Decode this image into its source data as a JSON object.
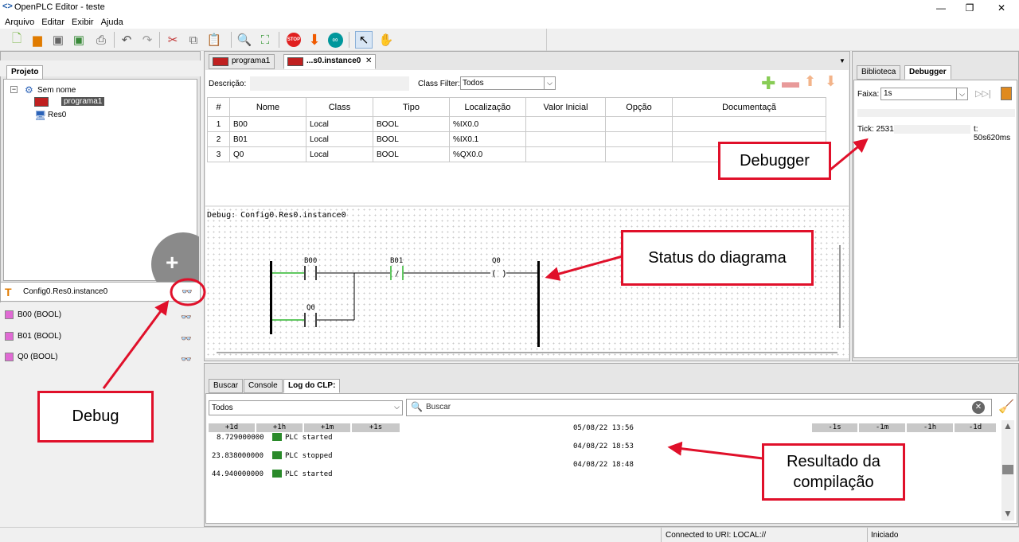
{
  "window": {
    "title": "OpenPLC Editor - teste",
    "logo": "<>"
  },
  "menu": [
    "Arquivo",
    "Editar",
    "Exibir",
    "Ajuda"
  ],
  "left_panel": {
    "tab": "Projeto",
    "tree": {
      "root": "Sem nome",
      "program": "programa1",
      "resource": "Res0"
    },
    "instance_label": "Config0.Res0.instance0",
    "variables": [
      "B00 (BOOL)",
      "B01 (BOOL)",
      "Q0 (BOOL)"
    ]
  },
  "editor": {
    "tabs": [
      "programa1",
      "...s0.instance0"
    ],
    "description_label": "Descrição:",
    "class_filter_label": "Class Filter:",
    "class_filter_value": "Todos",
    "columns": [
      "#",
      "Nome",
      "Class",
      "Tipo",
      "Localização",
      "Valor Inicial",
      "Opção",
      "Documentaçã"
    ],
    "rows": [
      [
        "1",
        "B00",
        "Local",
        "BOOL",
        "%IX0.0",
        "",
        "",
        ""
      ],
      [
        "2",
        "B01",
        "Local",
        "BOOL",
        "%IX0.1",
        "",
        "",
        ""
      ],
      [
        "3",
        "Q0",
        "Local",
        "BOOL",
        "%QX0.0",
        "",
        "",
        ""
      ]
    ],
    "debug_title": "Debug: Config0.Res0.instance0",
    "ladder": {
      "contact1": "B00",
      "contact2": "B01",
      "coil": "Q0",
      "contact3": "Q0",
      "contact2_symbol": "/",
      "coil_symbol": "( )"
    }
  },
  "right_panel": {
    "tabs": [
      "Biblioteca",
      "Debugger"
    ],
    "range_label": "Faixa:",
    "range_value": "1s",
    "tick_label": "Tick: 2531",
    "time_label": "t: 50s620ms"
  },
  "bottom": {
    "tabs": [
      "Buscar",
      "Console",
      "Log do CLP:"
    ],
    "filter_value": "Todos",
    "search_placeholder": "Buscar",
    "plus_buttons": [
      "+1d",
      "+1h",
      "+1m",
      "+1s"
    ],
    "minus_buttons": [
      "-1s",
      "-1m",
      "-1h",
      "-1d"
    ],
    "log": [
      {
        "time": "8.729000000",
        "msg": "PLC started",
        "date": "05/08/22 13:56"
      },
      {
        "time": "23.838000000",
        "msg": "PLC stopped",
        "date": "04/08/22 18:53"
      },
      {
        "time": "44.940000000",
        "msg": "PLC started",
        "date": "04/08/22 18:48"
      }
    ]
  },
  "status": {
    "uri": "Connected to URI: LOCAL://",
    "state": "Iniciado"
  },
  "annotations": {
    "debugger": "Debugger",
    "status_diagram": "Status do diagrama",
    "debug": "Debug",
    "compile_result": "Resultado da compilação"
  },
  "colors": {
    "callout_border": "#e0102a",
    "accent_green": "#2db52d",
    "stop_red": "#e02020"
  }
}
